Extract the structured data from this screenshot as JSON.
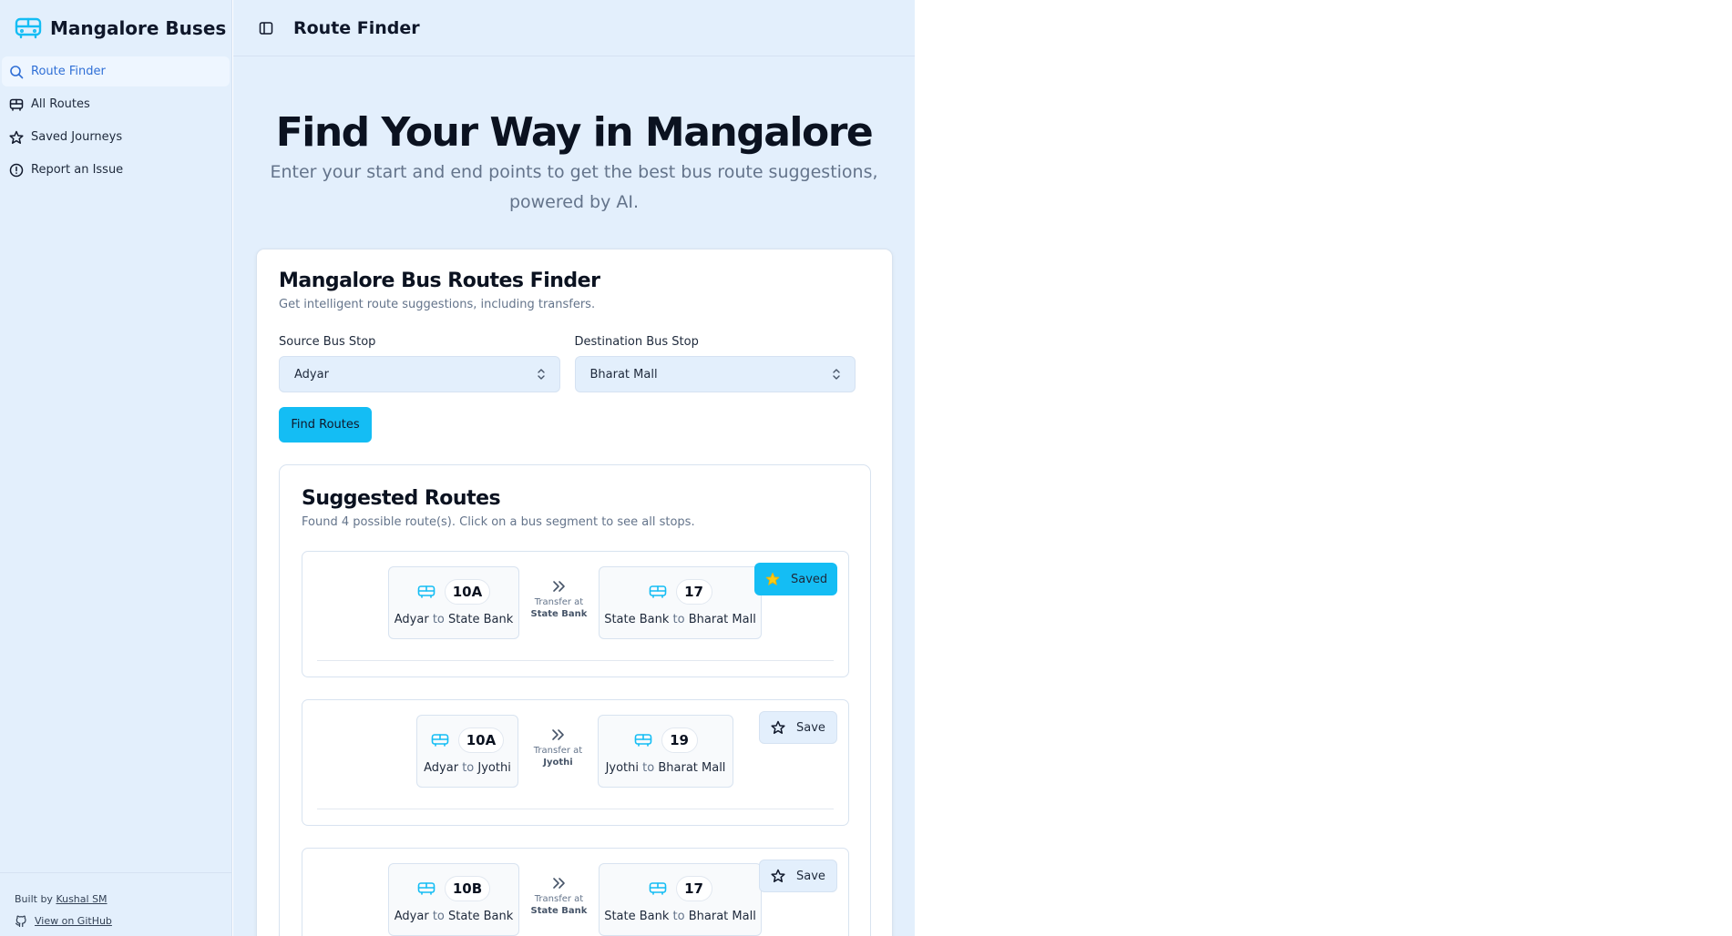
{
  "app": {
    "name": "Mangalore Buses"
  },
  "sidebar": {
    "items": [
      {
        "label": "Route Finder",
        "icon": "search-icon",
        "active": true
      },
      {
        "label": "All Routes",
        "icon": "bus-icon"
      },
      {
        "label": "Saved Journeys",
        "icon": "star-icon"
      },
      {
        "label": "Report an Issue",
        "icon": "alert-circle-icon"
      }
    ],
    "footer": {
      "built_by_prefix": "Built by",
      "author": "Kushal SM",
      "github_label": "View on GitHub"
    }
  },
  "header": {
    "title": "Route Finder"
  },
  "hero": {
    "title": "Find Your Way in Mangalore",
    "subtitle": "Enter your start and end points to get the best bus route suggestions, powered by AI."
  },
  "finder": {
    "title": "Mangalore Bus Routes Finder",
    "subtitle": "Get intelligent route suggestions, including transfers.",
    "source_label": "Source Bus Stop",
    "source_value": "Adyar",
    "destination_label": "Destination Bus Stop",
    "destination_value": "Bharat Mall",
    "find_button": "Find Routes"
  },
  "results": {
    "title": "Suggested Routes",
    "subtitle": "Found 4 possible route(s). Click on a bus segment to see all stops.",
    "routes": [
      {
        "seg1": {
          "bus": "10A",
          "from": "Adyar",
          "to": "State Bank"
        },
        "transfer_label": "Transfer at",
        "transfer_stop": "State Bank",
        "seg2": {
          "bus": "17",
          "from": "State Bank",
          "to": "Bharat Mall"
        },
        "save_label": "Saved",
        "saved": true
      },
      {
        "seg1": {
          "bus": "10A",
          "from": "Adyar",
          "to": "Jyothi"
        },
        "transfer_label": "Transfer at",
        "transfer_stop": "Jyothi",
        "seg2": {
          "bus": "19",
          "from": "Jyothi",
          "to": "Bharat Mall"
        },
        "save_label": "Save",
        "saved": false
      },
      {
        "seg1": {
          "bus": "10B",
          "from": "Adyar",
          "to": "State Bank"
        },
        "transfer_label": "Transfer at",
        "transfer_stop": "State Bank",
        "seg2": {
          "bus": "17",
          "from": "State Bank",
          "to": "Bharat Mall"
        },
        "save_label": "Save",
        "saved": false
      }
    ],
    "connector_word": "to"
  },
  "colors": {
    "accent": "#14bdf4",
    "background": "#e3effc",
    "link_active": "#2f6fd6",
    "star_saved": "#facc15"
  }
}
